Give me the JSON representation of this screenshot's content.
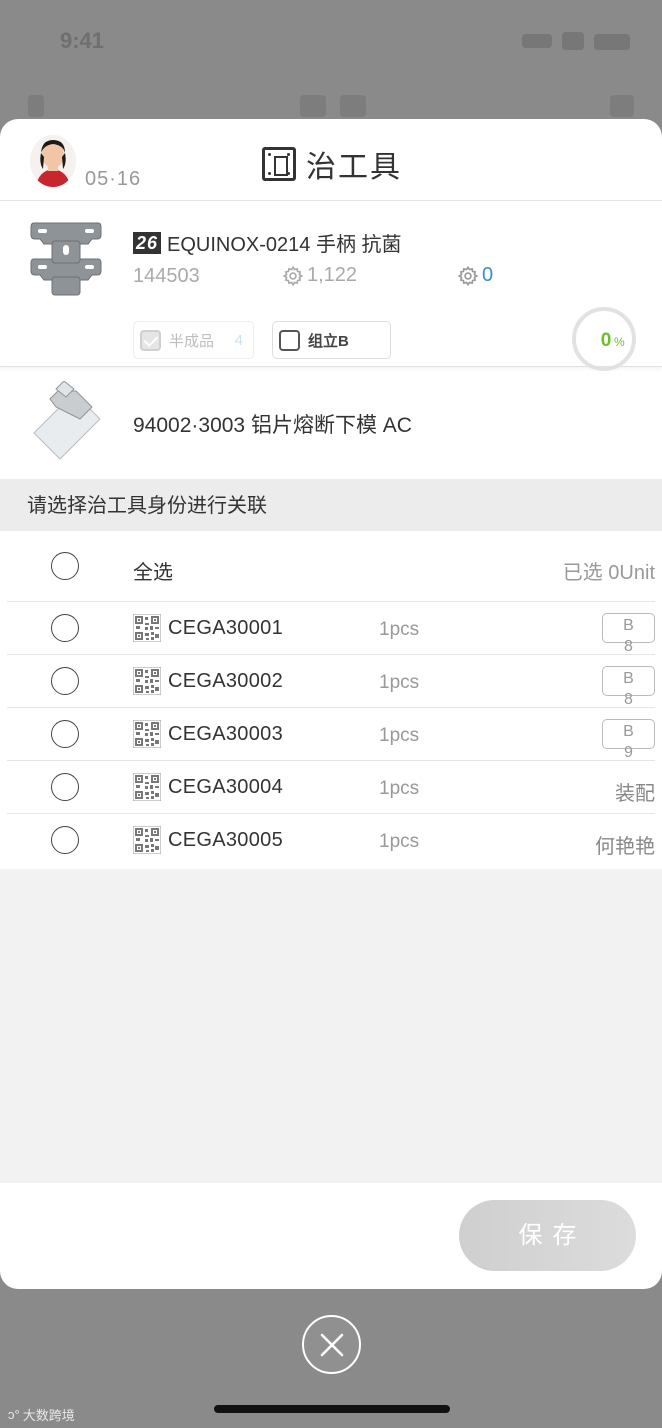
{
  "background": {
    "status_time": "9:41"
  },
  "header": {
    "date": "05·16",
    "title": "治工具"
  },
  "product": {
    "badge": "26",
    "name": "EQUINOX-0214 手柄 抗菌",
    "id": "144503",
    "stat1": "1,122",
    "stat2": "0",
    "progress_label": "0",
    "progress_unit": "%",
    "progress_value": 0,
    "tags": [
      {
        "label": "半成品",
        "count": "4",
        "checked": true,
        "disabled": true
      },
      {
        "label": "组立B",
        "checked": false,
        "disabled": false
      }
    ]
  },
  "fixture": {
    "name": "94002·3003 铝片熔断下模 AC"
  },
  "section": {
    "prompt": "请选择治工具身份进行关联"
  },
  "list": {
    "select_all_label": "全选",
    "selected_count": "已选 0Unit",
    "items": [
      {
        "code": "CEGA30001",
        "qty": "1pcs",
        "status_letter": "B",
        "status_number": "8"
      },
      {
        "code": "CEGA30002",
        "qty": "1pcs",
        "status_letter": "B",
        "status_number": "8"
      },
      {
        "code": "CEGA30003",
        "qty": "1pcs",
        "status_letter": "B",
        "status_number": "9"
      },
      {
        "code": "CEGA30004",
        "qty": "1pcs",
        "status_text": "装配"
      },
      {
        "code": "CEGA30005",
        "qty": "1pcs",
        "status_text": "何艳艳"
      }
    ]
  },
  "actions": {
    "save_label": "保存"
  },
  "watermark": "大数跨境",
  "colors": {
    "accent_blue": "#3a8fc7",
    "progress_green": "#6abf2a",
    "save_disabled": "#d4d4d4"
  }
}
